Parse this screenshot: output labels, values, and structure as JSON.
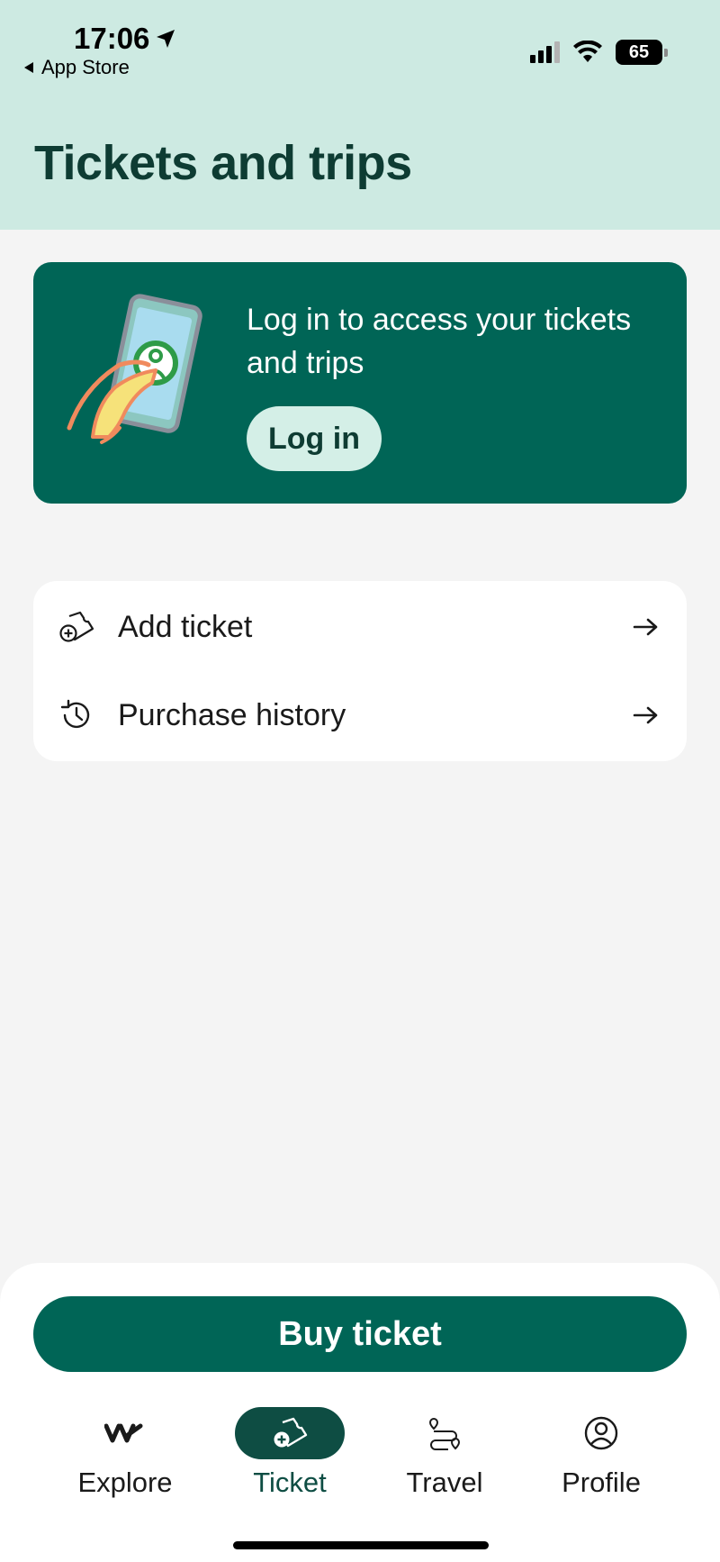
{
  "status_bar": {
    "time": "17:06",
    "back_label": "App Store",
    "battery": "65"
  },
  "header": {
    "title": "Tickets and trips"
  },
  "login_card": {
    "message": "Log in to access your tickets and trips",
    "button_label": "Log in"
  },
  "menu": {
    "items": [
      {
        "label": "Add ticket",
        "icon": "ticket-add-icon"
      },
      {
        "label": "Purchase history",
        "icon": "history-icon"
      }
    ]
  },
  "buy_button_label": "Buy ticket",
  "tab_bar": {
    "items": [
      {
        "label": "Explore",
        "icon": "vy-logo-icon",
        "active": false
      },
      {
        "label": "Ticket",
        "icon": "ticket-add-icon",
        "active": true
      },
      {
        "label": "Travel",
        "icon": "route-icon",
        "active": false
      },
      {
        "label": "Profile",
        "icon": "profile-icon",
        "active": false
      }
    ]
  },
  "colors": {
    "header_bg": "#cdeae2",
    "primary": "#006556",
    "title": "#0e3c33",
    "accent_light": "#d4efe7",
    "background": "#f4f4f4"
  }
}
